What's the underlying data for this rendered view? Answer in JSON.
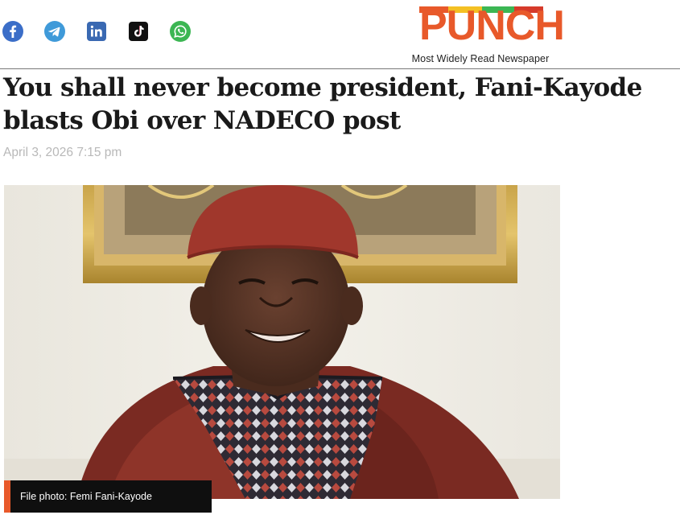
{
  "share": {
    "icons": [
      "facebook-icon",
      "telegram-icon",
      "linkedin-icon",
      "tiktok-icon",
      "whatsapp-icon"
    ]
  },
  "brand": {
    "logo_text": "PUNCH",
    "tagline": "Most Widely Read Newspaper",
    "colors": {
      "orange": "#e8592a",
      "yellow": "#f4c023",
      "green": "#3cb653",
      "red": "#d63a2a"
    }
  },
  "article": {
    "headline": "You shall never become president, Fani-Kayode blasts Obi over NADECO post",
    "date": "April 3, 2026 7:15 pm",
    "photo_caption": "File photo: Femi Fani-Kayode"
  }
}
